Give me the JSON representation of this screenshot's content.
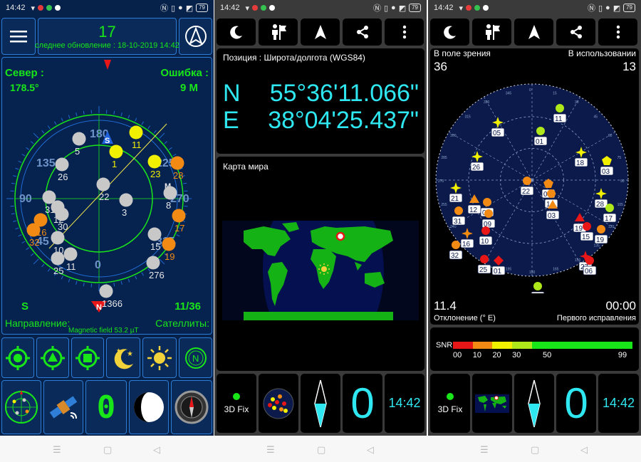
{
  "status": {
    "time": "14:42",
    "battery": "79"
  },
  "panel1": {
    "satellites_in_use": "17",
    "last_update": "следнее обновление : 18-10-2019 14:42",
    "north_label": "Север :",
    "north_value": "178.5°",
    "error_label": "Ошибка :",
    "error_value": "9 М",
    "bottom_left_value": "S",
    "bottom_right_value": "11/36",
    "direction_label": "Направление:",
    "satellites_label": "Сателлиты:",
    "magnetic_field": "Magnetic field 53.2 µT",
    "compass_heading_labels": [
      "180",
      "135",
      "225",
      "90",
      "270",
      "45",
      "315",
      "0"
    ],
    "sat_labels": [
      "11",
      "5",
      "1",
      "23",
      "26",
      "28",
      "22",
      "3",
      "31",
      "12",
      "30",
      "8",
      "17",
      "16",
      "32",
      "10",
      "15",
      "19",
      "25",
      "11",
      "276",
      "1366"
    ],
    "counter_digit": "0",
    "compass_letters": [
      "S",
      "M",
      "N"
    ]
  },
  "panel2": {
    "position_title": "Позиция : Широта/долгота (WGS84)",
    "lat_hem": "N",
    "lat_value": "55°36'11.066\"",
    "lon_hem": "E",
    "lon_value": "38°04'25.437\"",
    "map_title": "Карта мира",
    "fix_label": "3D Fix",
    "big_digit": "0",
    "clock": "14:42"
  },
  "panel3": {
    "in_view_label": "В поле зрения",
    "in_view_value": "36",
    "in_use_label": "В использовании",
    "in_use_value": "13",
    "declination_value": "11.4",
    "declination_label": "Отклонение (° E)",
    "first_fix_value": "00:00",
    "first_fix_label": "Первого исправления",
    "snr_label": "SNR",
    "snr_ticks": [
      "00",
      "10",
      "20",
      "30",
      "50",
      "99"
    ],
    "fix_label": "3D Fix",
    "big_digit": "0",
    "clock": "14:42",
    "sky_sats": [
      "05",
      "11",
      "01",
      "18",
      "03",
      "26",
      "22",
      "05",
      "21",
      "14",
      "03",
      "28",
      "17",
      "12",
      "09",
      "31",
      "09",
      "19",
      "15",
      "19",
      "16",
      "10",
      "32",
      "25",
      "01",
      "27",
      "06",
      "136"
    ]
  },
  "colors": {
    "accent_green": "#19e619",
    "accent_cyan": "#2fe7f0",
    "sat_yellow": "#f1f000",
    "sat_orange": "#f38a14",
    "sat_gray": "#c8c8c8",
    "sat_red": "#e81616"
  }
}
